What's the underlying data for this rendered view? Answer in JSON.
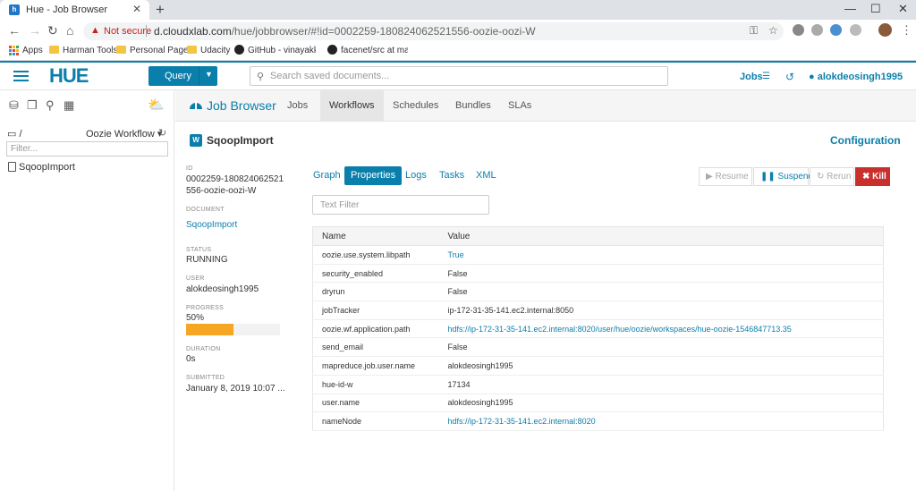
{
  "browser": {
    "tab_title": "Hue - Job Browser",
    "tab_favicon": "h",
    "security_label": "Not secure",
    "url_host": "d.cloudxlab.com",
    "url_path": "/hue/jobbrowser/#!id=0002259-180824062521556-oozie-oozi-W",
    "bookmarks": [
      {
        "label": "Apps",
        "icon": "apps-grid-icon"
      },
      {
        "label": "Harman Tools",
        "icon": "folder-icon"
      },
      {
        "label": "Personal Pages",
        "icon": "folder-icon"
      },
      {
        "label": "Udacity",
        "icon": "folder-icon"
      },
      {
        "label": "GitHub - vinayakkaila",
        "icon": "github-icon"
      },
      {
        "label": "facenet/src at maste",
        "icon": "github-icon"
      }
    ]
  },
  "header": {
    "logo": "HUE",
    "query_label": "Query",
    "search_placeholder": "Search saved documents...",
    "jobs_label": "Jobs",
    "user": "alokdeosingh1995",
    "accent_color": "#0b7fab"
  },
  "left_panel": {
    "path": "/",
    "source": "Oozie Workflow",
    "filter_placeholder": "Filter...",
    "items": [
      "SqoopImport"
    ]
  },
  "job_browser": {
    "title": "Job Browser",
    "tabs": [
      "Jobs",
      "Workflows",
      "Schedules",
      "Bundles",
      "SLAs"
    ],
    "active_tab": "Workflows"
  },
  "workflow": {
    "badge": "W",
    "name": "SqoopImport",
    "configuration_label": "Configuration",
    "id_label": "ID",
    "id_line1": "0002259-180824062521",
    "id_line2": "556-oozie-oozi-W",
    "document_label": "DOCUMENT",
    "document": "SqoopImport",
    "status_label": "STATUS",
    "status": "RUNNING",
    "user_label": "USER",
    "user": "alokdeosingh1995",
    "progress_label": "PROGRESS",
    "progress_text": "50%",
    "progress_percent": 50,
    "duration_label": "DURATION",
    "duration": "0s",
    "submitted_label": "SUBMITTED",
    "submitted": "January 8, 2019 10:07 ..."
  },
  "subtabs": [
    "Graph",
    "Properties",
    "Logs",
    "Tasks",
    "XML"
  ],
  "active_subtab": "Properties",
  "actions": {
    "resume": "Resume",
    "suspend": "Suspend",
    "rerun": "Rerun",
    "kill": "Kill"
  },
  "text_filter_placeholder": "Text Filter",
  "properties": {
    "headers": [
      "Name",
      "Value"
    ],
    "rows": [
      {
        "name": "oozie.use.system.libpath",
        "value": "True",
        "link": true
      },
      {
        "name": "security_enabled",
        "value": "False",
        "link": false
      },
      {
        "name": "dryrun",
        "value": "False",
        "link": false
      },
      {
        "name": "jobTracker",
        "value": "ip-172-31-35-141.ec2.internal:8050",
        "link": false
      },
      {
        "name": "oozie.wf.application.path",
        "value": "hdfs://ip-172-31-35-141.ec2.internal:8020/user/hue/oozie/workspaces/hue-oozie-1546847713.35",
        "link": true
      },
      {
        "name": "send_email",
        "value": "False",
        "link": false
      },
      {
        "name": "mapreduce.job.user.name",
        "value": "alokdeosingh1995",
        "link": false
      },
      {
        "name": "hue-id-w",
        "value": "17134",
        "link": false
      },
      {
        "name": "user.name",
        "value": "alokdeosingh1995",
        "link": false
      },
      {
        "name": "nameNode",
        "value": "hdfs://ip-172-31-35-141.ec2.internal:8020",
        "link": true
      }
    ]
  }
}
